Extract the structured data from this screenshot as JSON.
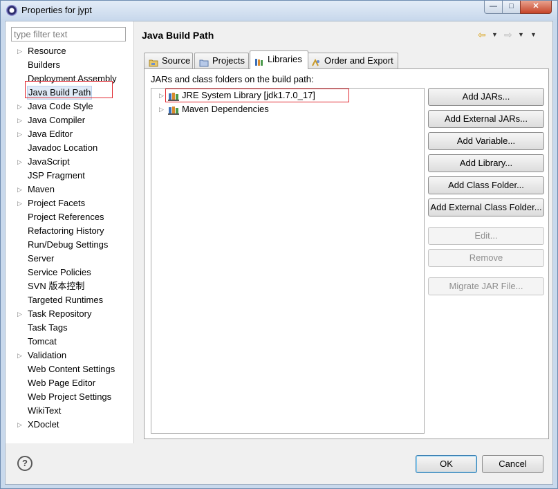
{
  "window": {
    "title": "Properties for jypt"
  },
  "sidebar": {
    "filter_placeholder": "type filter text",
    "items": [
      {
        "label": "Resource",
        "arrow": true
      },
      {
        "label": "Builders",
        "arrow": false
      },
      {
        "label": "Deployment Assembly",
        "arrow": false
      },
      {
        "label": "Java Build Path",
        "arrow": false,
        "selected": true
      },
      {
        "label": "Java Code Style",
        "arrow": true
      },
      {
        "label": "Java Compiler",
        "arrow": true
      },
      {
        "label": "Java Editor",
        "arrow": true
      },
      {
        "label": "Javadoc Location",
        "arrow": false
      },
      {
        "label": "JavaScript",
        "arrow": true
      },
      {
        "label": "JSP Fragment",
        "arrow": false
      },
      {
        "label": "Maven",
        "arrow": true
      },
      {
        "label": "Project Facets",
        "arrow": true
      },
      {
        "label": "Project References",
        "arrow": false
      },
      {
        "label": "Refactoring History",
        "arrow": false
      },
      {
        "label": "Run/Debug Settings",
        "arrow": false
      },
      {
        "label": "Server",
        "arrow": false
      },
      {
        "label": "Service Policies",
        "arrow": false
      },
      {
        "label": "SVN 版本控制",
        "arrow": false
      },
      {
        "label": "Targeted Runtimes",
        "arrow": false
      },
      {
        "label": "Task Repository",
        "arrow": true
      },
      {
        "label": "Task Tags",
        "arrow": false
      },
      {
        "label": "Tomcat",
        "arrow": false
      },
      {
        "label": "Validation",
        "arrow": true
      },
      {
        "label": "Web Content Settings",
        "arrow": false
      },
      {
        "label": "Web Page Editor",
        "arrow": false
      },
      {
        "label": "Web Project Settings",
        "arrow": false
      },
      {
        "label": "WikiText",
        "arrow": false
      },
      {
        "label": "XDoclet",
        "arrow": true
      }
    ]
  },
  "main": {
    "title": "Java Build Path",
    "tabs": [
      {
        "label": "Source",
        "icon": "source-folder-icon"
      },
      {
        "label": "Projects",
        "icon": "projects-icon"
      },
      {
        "label": "Libraries",
        "icon": "libraries-icon",
        "active": true
      },
      {
        "label": "Order and Export",
        "icon": "order-export-icon"
      }
    ],
    "section_label": "JARs and class folders on the build path:",
    "libraries": [
      {
        "label": "JRE System Library [jdk1.7.0_17]",
        "icon": "library-icon"
      },
      {
        "label": "Maven Dependencies",
        "icon": "library-icon"
      }
    ],
    "buttons": [
      {
        "label": "Add JARs...",
        "enabled": true
      },
      {
        "label": "Add External JARs...",
        "enabled": true
      },
      {
        "label": "Add Variable...",
        "enabled": true
      },
      {
        "label": "Add Library...",
        "enabled": true
      },
      {
        "label": "Add Class Folder...",
        "enabled": true
      },
      {
        "label": "Add External Class Folder...",
        "enabled": true
      },
      {
        "label": "Edit...",
        "enabled": false
      },
      {
        "label": "Remove",
        "enabled": false
      },
      {
        "label": "Migrate JAR File...",
        "enabled": false
      }
    ]
  },
  "footer": {
    "ok_label": "OK",
    "cancel_label": "Cancel",
    "help_label": "?"
  },
  "colors": {
    "highlight_box": "#e0262e",
    "selection_bg": "#dfeaf7",
    "ok_border": "#3c7fb1"
  }
}
